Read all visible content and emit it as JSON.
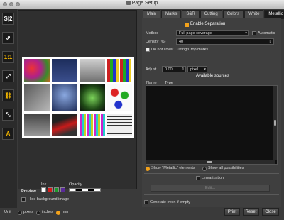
{
  "window": {
    "title": "Page Setup"
  },
  "tabs": [
    "Main",
    "Marks",
    "S&R",
    "Cutting",
    "Colors",
    "White",
    "Metallic"
  ],
  "active_tab": "Metallic",
  "separation": {
    "header": "Enable Separation",
    "method_label": "Method",
    "method_value": "Full page coverage",
    "automatic_label": "Automatic",
    "density_label": "Density (%)",
    "density_value": "40",
    "nocover_label": "Do not cover Cutting/Crop marks"
  },
  "adjust": {
    "label": "Adjust",
    "value": "0.00",
    "unit": "pixel"
  },
  "sources": {
    "header": "Available sources",
    "col_name": "Name",
    "col_type": "Type"
  },
  "show_options": {
    "metallic_label": "Show \"Metallic\" elements",
    "all_label": "Show all possibilities"
  },
  "linearization": {
    "label": "Linearization",
    "edit_label": "Edit..."
  },
  "generate_label": "Generate even if empty",
  "preview": {
    "label": "Preview",
    "ink_label": "Ink",
    "opacity_label": "Opacity",
    "hide_bg_label": "Hide background image"
  },
  "unit": {
    "label": "Unit",
    "options": [
      "pixels",
      "inches",
      "mm"
    ],
    "selected": "mm"
  },
  "buttons": {
    "print": "Print",
    "reset": "Reset",
    "close": "Close"
  },
  "toolbar_icons": [
    "S|2",
    "⇗",
    "1:1",
    "⤢",
    "⛓",
    "⤡",
    "A"
  ],
  "colors": {
    "accent": "#f3a21b"
  }
}
